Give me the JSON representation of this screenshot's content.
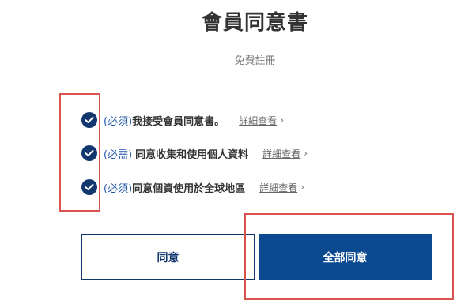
{
  "header": {
    "title": "會員同意書",
    "subtitle": "免費註冊"
  },
  "consents": [
    {
      "required_tag": "(必須)",
      "label": "我接受會員同意書。",
      "detail_link": "詳細查看",
      "checked": true
    },
    {
      "required_tag": "(必需)",
      "label": "同意收集和使用個人資料",
      "detail_link": "詳細查看",
      "checked": true
    },
    {
      "required_tag": "(必須)",
      "label": "同意個資使用於全球地區",
      "detail_link": "詳細查看",
      "checked": true
    }
  ],
  "buttons": {
    "agree": "同意",
    "agree_all": "全部同意"
  },
  "icons": {
    "check": "check-circle-icon",
    "chevron": "chevron-right-icon"
  },
  "colors": {
    "primary": "#0b4a91",
    "check_fill": "#12376e",
    "required_tag": "#2459a8",
    "highlight": "#d9534f"
  }
}
